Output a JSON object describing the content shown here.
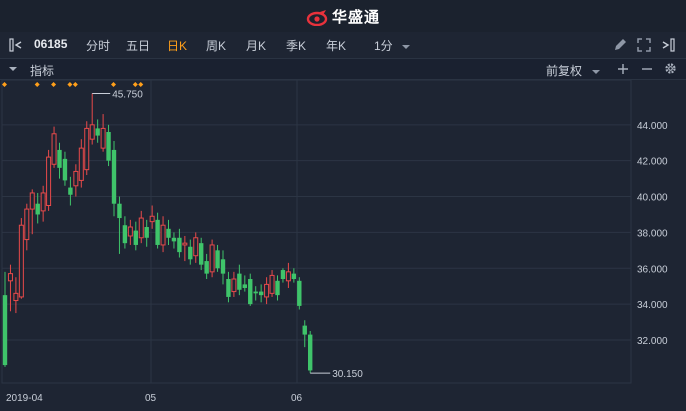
{
  "app": {
    "title": "华盛通"
  },
  "toolbar": {
    "code": "06185",
    "periods": [
      {
        "label": "分时",
        "active": false
      },
      {
        "label": "五日",
        "active": false
      },
      {
        "label": "日K",
        "active": true
      },
      {
        "label": "周K",
        "active": false
      },
      {
        "label": "月K",
        "active": false
      },
      {
        "label": "季K",
        "active": false
      },
      {
        "label": "年K",
        "active": false
      }
    ],
    "minute_select": "1分"
  },
  "indicator_bar": {
    "label": "指标",
    "adjust_select": "前复权"
  },
  "colors": {
    "up": "#e84a4a",
    "down": "#3fc46a",
    "grid": "#2c3544",
    "accent": "#ff9f1a"
  },
  "chart_data": {
    "type": "candlestick",
    "y_ticks": [
      "44.000",
      "42.000",
      "40.000",
      "38.000",
      "36.000",
      "34.000",
      "32.000"
    ],
    "x_ticks": [
      "2019-04",
      "05",
      "06"
    ],
    "ylim": [
      29.6,
      46.5
    ],
    "high_label": "45.750",
    "low_label": "30.150",
    "event_markers": [
      0,
      6,
      9,
      12,
      13,
      20,
      24,
      25
    ],
    "candles": [
      [
        34.5,
        30.6,
        30.5,
        35.8
      ],
      [
        35.3,
        35.7,
        33.6,
        36.2
      ],
      [
        34.2,
        34.6,
        33.5,
        35.5
      ],
      [
        34.4,
        38.4,
        34.3,
        38.8
      ],
      [
        37.6,
        39.3,
        37.0,
        39.6
      ],
      [
        39.3,
        40.2,
        37.9,
        40.4
      ],
      [
        39.6,
        39.0,
        38.5,
        40.2
      ],
      [
        39.2,
        40.2,
        38.6,
        40.6
      ],
      [
        39.5,
        42.2,
        39.2,
        42.6
      ],
      [
        41.8,
        43.5,
        41.6,
        43.9
      ],
      [
        42.6,
        41.6,
        41.0,
        43.0
      ],
      [
        42.1,
        40.9,
        40.6,
        42.5
      ],
      [
        40.5,
        40.1,
        39.5,
        41.1
      ],
      [
        40.6,
        41.4,
        40.0,
        41.8
      ],
      [
        40.9,
        42.7,
        40.5,
        43.2
      ],
      [
        41.5,
        43.8,
        41.2,
        44.2
      ],
      [
        43.2,
        44.0,
        42.9,
        45.75
      ],
      [
        43.8,
        43.4,
        43.0,
        44.3
      ],
      [
        42.7,
        43.8,
        42.5,
        44.6
      ],
      [
        43.6,
        42.0,
        41.7,
        44.0
      ],
      [
        42.6,
        39.6,
        38.9,
        43.1
      ],
      [
        39.6,
        38.8,
        36.8,
        40.0
      ],
      [
        38.4,
        37.4,
        37.1,
        38.9
      ],
      [
        37.8,
        38.3,
        37.3,
        38.7
      ],
      [
        38.1,
        37.3,
        37.0,
        38.6
      ],
      [
        37.7,
        38.8,
        37.4,
        39.2
      ],
      [
        38.3,
        37.7,
        37.2,
        38.7
      ],
      [
        38.6,
        38.9,
        38.2,
        39.5
      ],
      [
        38.7,
        37.3,
        37.1,
        39.1
      ],
      [
        37.3,
        38.4,
        36.9,
        38.9
      ],
      [
        38.2,
        37.7,
        37.3,
        38.7
      ],
      [
        37.7,
        37.5,
        37.1,
        38.0
      ],
      [
        37.7,
        36.9,
        36.6,
        38.2
      ],
      [
        37.3,
        37.4,
        36.4,
        37.8
      ],
      [
        37.2,
        36.5,
        36.2,
        37.6
      ],
      [
        36.7,
        37.7,
        36.3,
        38.0
      ],
      [
        37.4,
        36.2,
        35.9,
        37.7
      ],
      [
        36.4,
        35.7,
        35.4,
        36.8
      ],
      [
        35.8,
        37.3,
        35.5,
        37.6
      ],
      [
        37.0,
        36.0,
        35.8,
        37.3
      ],
      [
        36.5,
        35.7,
        35.1,
        37.0
      ],
      [
        35.4,
        34.4,
        34.1,
        35.8
      ],
      [
        34.7,
        35.4,
        34.4,
        35.8
      ],
      [
        35.7,
        34.8,
        34.5,
        36.2
      ],
      [
        35.1,
        34.9,
        34.7,
        35.6
      ],
      [
        35.4,
        34.0,
        33.9,
        35.7
      ],
      [
        34.7,
        34.6,
        34.2,
        35.0
      ],
      [
        34.7,
        34.5,
        34.1,
        35.1
      ],
      [
        34.4,
        35.1,
        34.0,
        35.5
      ],
      [
        34.6,
        35.6,
        34.4,
        35.9
      ],
      [
        35.3,
        34.5,
        34.2,
        35.6
      ],
      [
        35.9,
        35.4,
        35.2,
        36.0
      ],
      [
        35.3,
        35.8,
        34.9,
        36.3
      ],
      [
        35.7,
        35.4,
        35.2,
        36.0
      ],
      [
        35.3,
        33.9,
        33.7,
        35.5
      ],
      [
        32.8,
        32.3,
        31.6,
        33.1
      ],
      [
        32.3,
        30.3,
        30.15,
        32.5
      ]
    ]
  }
}
